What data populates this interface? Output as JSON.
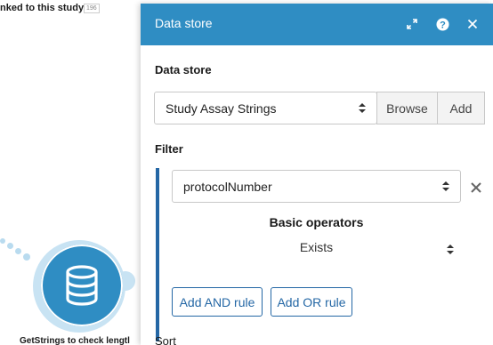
{
  "background": {
    "module_link_label": "nked to this study",
    "module_link_badge": "196",
    "node_label": "GetStrings to check lengtl",
    "node_icon": "database-icon",
    "node_color": "#2f8dc3"
  },
  "panel": {
    "title": "Data store",
    "header_color": "#2f8dc3",
    "header_icons": [
      "expand-icon",
      "help-icon",
      "close-icon"
    ],
    "data_store": {
      "label": "Data store",
      "selected": "Study Assay Strings",
      "browse_label": "Browse",
      "add_label": "Add"
    },
    "filter": {
      "label": "Filter",
      "field_selected": "protocolNumber",
      "operators_heading": "Basic operators",
      "operator_selected": "Exists",
      "add_and_label": "Add AND rule",
      "add_or_label": "Add OR rule",
      "accent_color": "#2467a5"
    },
    "sort": {
      "label": "Sort"
    }
  }
}
